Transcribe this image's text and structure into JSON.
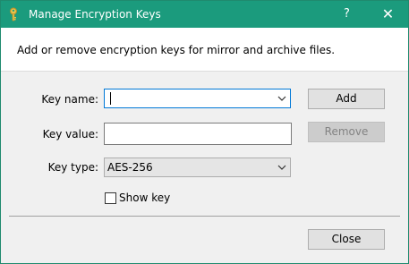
{
  "window": {
    "title": "Manage Encryption Keys",
    "help_glyph": "?",
    "close_glyph": "✕",
    "accent_color": "#1b9b7d"
  },
  "description": "Add or remove encryption keys for mirror and archive files.",
  "form": {
    "key_name_label": "Key name:",
    "key_name_value": "",
    "key_value_label": "Key value:",
    "key_value_value": "",
    "key_type_label": "Key type:",
    "key_type_selected": "AES-256",
    "show_key_label": "Show key",
    "show_key_checked": false
  },
  "buttons": {
    "add": "Add",
    "remove": "Remove",
    "close": "Close"
  },
  "icons": {
    "title_icon": "key-icon",
    "dropdown": "chevron-down-icon"
  }
}
